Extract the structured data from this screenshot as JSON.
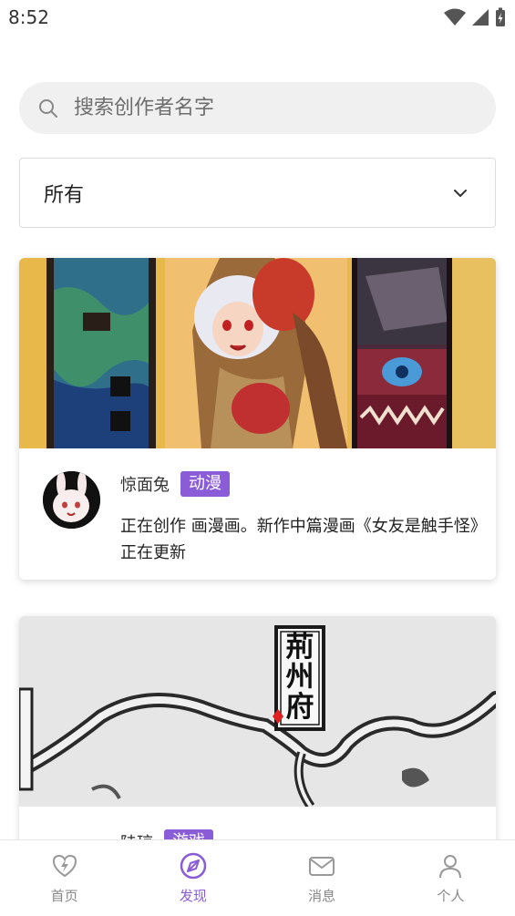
{
  "status": {
    "time": "8:52"
  },
  "search": {
    "placeholder": "搜索创作者名字"
  },
  "filter": {
    "selected": "所有"
  },
  "cards": [
    {
      "name": "惊面兔",
      "tag": "动漫",
      "description": "正在创作 画漫画。新作中篇漫画《女友是触手怪》正在更新"
    },
    {
      "name": "陆琼",
      "tag": "游戏",
      "banner_text": "荊州府"
    }
  ],
  "nav": {
    "items": [
      {
        "label": "首页",
        "icon": "heart-bolt-icon"
      },
      {
        "label": "发现",
        "icon": "compass-icon",
        "active": true
      },
      {
        "label": "消息",
        "icon": "mail-icon"
      },
      {
        "label": "个人",
        "icon": "person-icon"
      }
    ]
  },
  "colors": {
    "accent": "#8a5cd8",
    "search_bg": "#f0f0f0"
  }
}
